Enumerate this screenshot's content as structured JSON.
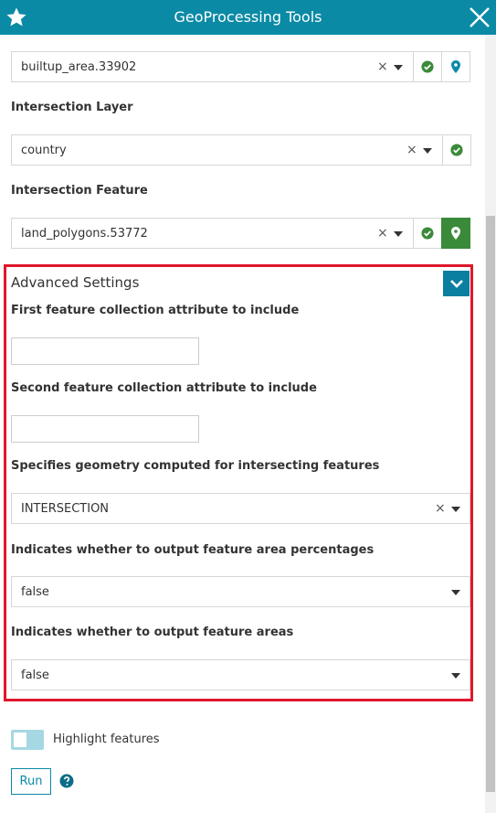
{
  "header": {
    "title": "GeoProcessing Tools",
    "star_icon": "star-icon",
    "close_icon": "close-icon"
  },
  "fields": {
    "input_layer": {
      "value": "builtup_area.33902"
    },
    "intersection_layer": {
      "label": "Intersection Layer",
      "value": "country"
    },
    "intersection_feature": {
      "label": "Intersection Feature",
      "value": "land_polygons.53772"
    }
  },
  "advanced": {
    "title": "Advanced Settings",
    "first_attr": {
      "label": "First feature collection attribute to include",
      "value": ""
    },
    "second_attr": {
      "label": "Second feature collection attribute to include",
      "value": ""
    },
    "geometry": {
      "label": "Specifies geometry computed for intersecting features",
      "value": "INTERSECTION"
    },
    "area_percent": {
      "label": "Indicates whether to output feature area percentages",
      "value": "false"
    },
    "areas": {
      "label": "Indicates whether to output feature areas",
      "value": "false"
    }
  },
  "highlight": {
    "label": "Highlight features"
  },
  "run": {
    "label": "Run"
  },
  "colors": {
    "header": "#0b8aa6",
    "accent_green": "#3a8a3a",
    "highlight_border": "#e0162b"
  }
}
